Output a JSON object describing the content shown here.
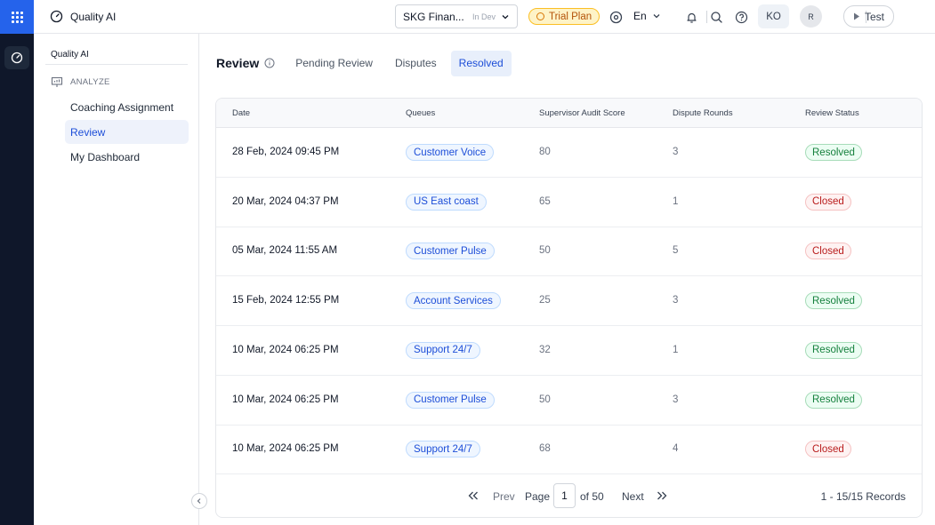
{
  "app": {
    "title": "Quality AI"
  },
  "topbar": {
    "org_name": "SKG Finan...",
    "org_env": "In Dev",
    "trial_label": "Trial Plan",
    "language": "En",
    "user_initials": "KO",
    "avatar_initial": "R",
    "test_label": "Test"
  },
  "sidebar": {
    "header": "Quality AI",
    "section": "ANALYZE",
    "items": [
      {
        "label": "Coaching Assignment"
      },
      {
        "label": "Review"
      },
      {
        "label": "My Dashboard"
      }
    ]
  },
  "main": {
    "title": "Review",
    "tabs": [
      {
        "label": "Pending Review"
      },
      {
        "label": "Disputes"
      },
      {
        "label": "Resolved"
      }
    ]
  },
  "table": {
    "columns": [
      "Date",
      "Queues",
      "Supervisor Audit Score",
      "Dispute Rounds",
      "Review Status"
    ],
    "rows": [
      {
        "date": "28 Feb, 2024 09:45 PM",
        "queue": "Customer Voice",
        "score": "80",
        "rounds": "3",
        "status": "Resolved"
      },
      {
        "date": "20 Mar, 2024 04:37 PM",
        "queue": "US East coast",
        "score": "65",
        "rounds": "1",
        "status": "Closed"
      },
      {
        "date": "05 Mar, 2024 11:55 AM",
        "queue": "Customer Pulse",
        "score": "50",
        "rounds": "5",
        "status": "Closed"
      },
      {
        "date": "15 Feb, 2024 12:55 PM",
        "queue": "Account Services",
        "score": "25",
        "rounds": "3",
        "status": "Resolved"
      },
      {
        "date": "10 Mar, 2024 06:25 PM",
        "queue": "Support 24/7",
        "score": "32",
        "rounds": "1",
        "status": "Resolved"
      },
      {
        "date": "10 Mar, 2024 06:25 PM",
        "queue": "Customer Pulse",
        "score": "50",
        "rounds": "3",
        "status": "Resolved"
      },
      {
        "date": "10 Mar, 2024 06:25 PM",
        "queue": "Support 24/7",
        "score": "68",
        "rounds": "4",
        "status": "Closed"
      }
    ]
  },
  "pagination": {
    "prev": "Prev",
    "page_label": "Page",
    "current": "1",
    "of_label": "of 50",
    "next": "Next",
    "records": "1 - 15/15 Records"
  },
  "colors": {
    "rail": "#0f172a",
    "accent": "#2563eb",
    "resolved": "#15803d",
    "closed": "#b91c1c",
    "trial": "#b45309"
  }
}
